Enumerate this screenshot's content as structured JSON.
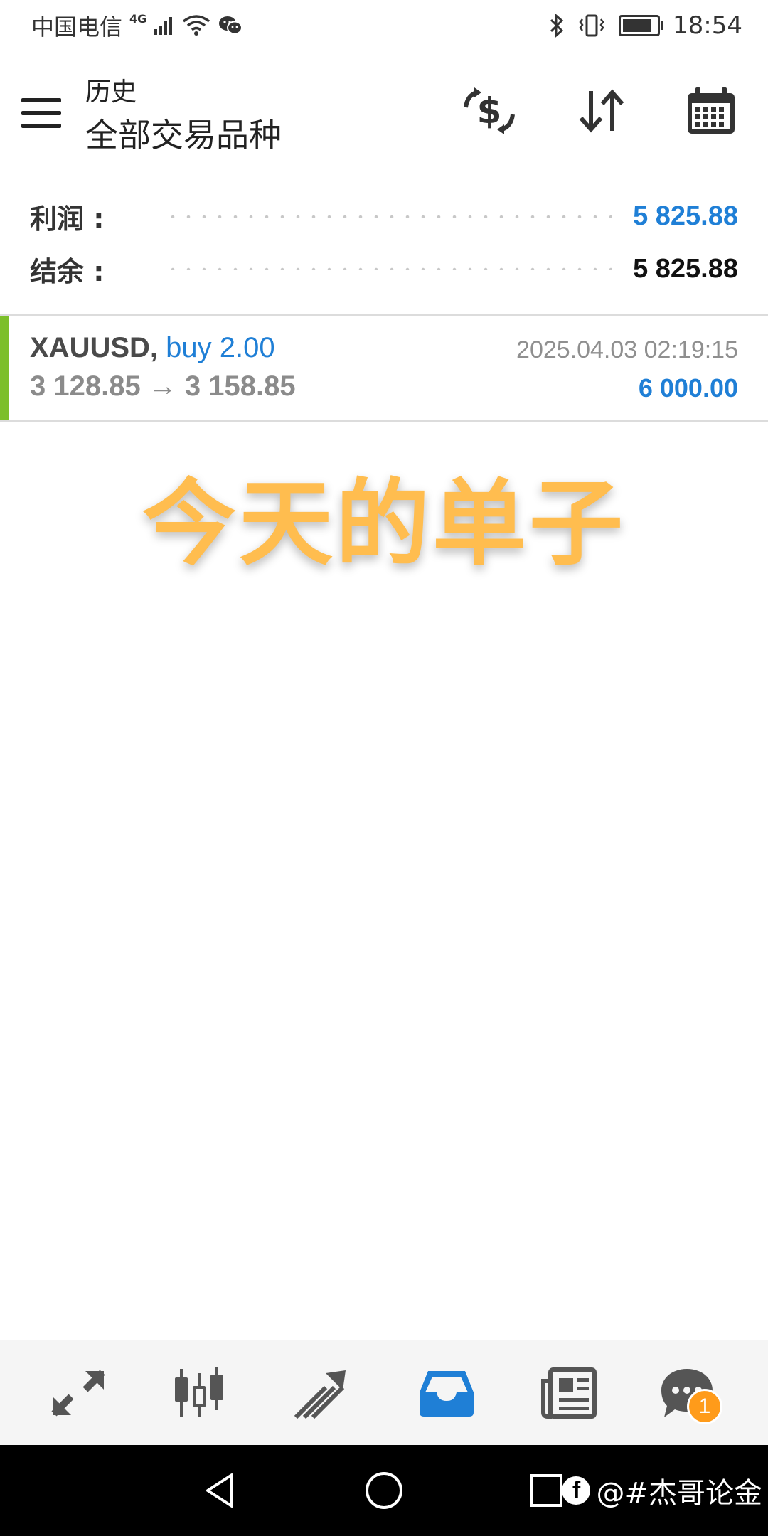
{
  "status_bar": {
    "carrier": "中国电信",
    "network": "4G",
    "time": "18:54"
  },
  "header": {
    "section": "历史",
    "filter": "全部交易品种"
  },
  "summary": {
    "profit_label": "利润 :",
    "profit_value": "5 825.88",
    "balance_label": "结余 :",
    "balance_value": "5 825.88"
  },
  "trade": {
    "symbol": "XAUUSD,",
    "side": "buy 2.00",
    "prices": "3 128.85 → 3 158.85",
    "time": "2025.04.03 02:19:15",
    "profit": "6 000.00"
  },
  "overlay": {
    "caption": "今天的单子"
  },
  "bottom_nav": {
    "chat_badge": "1"
  },
  "watermark": {
    "text": "@#杰哥论金"
  },
  "colors": {
    "accent_blue": "#1f7fd6",
    "buy_green": "#7cbf2a",
    "caption_orange": "#ffbd4f",
    "badge_orange": "#ff9b1a"
  }
}
